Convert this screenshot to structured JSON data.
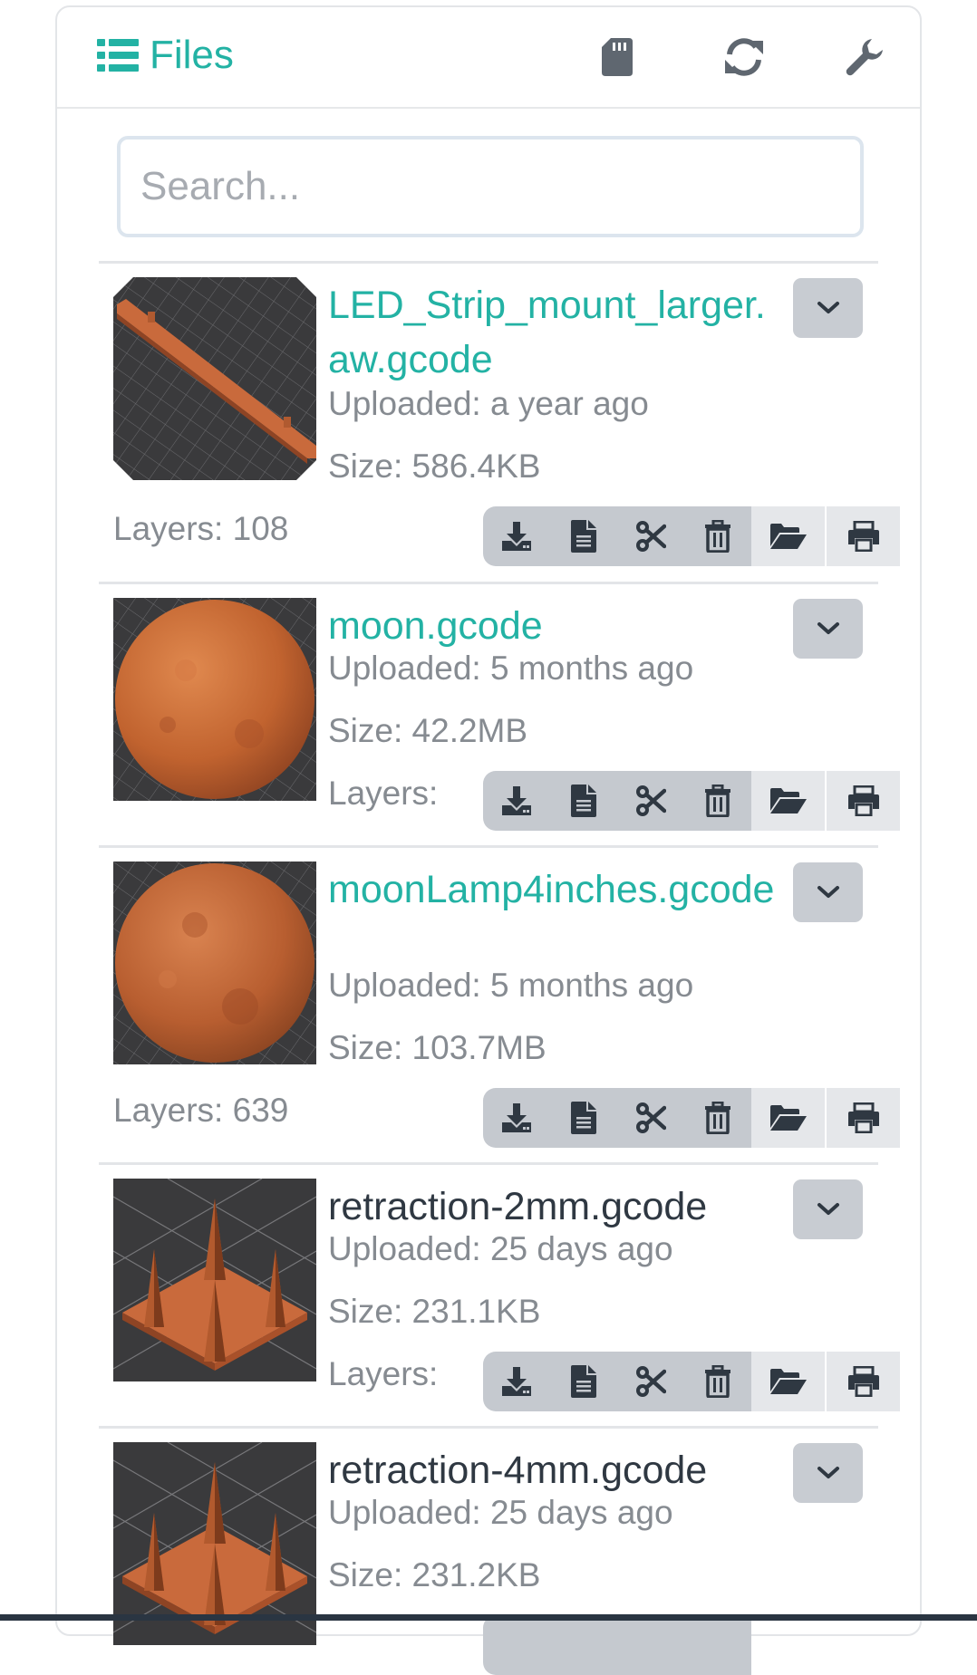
{
  "header": {
    "title": "Files",
    "icons": [
      "list-icon",
      "sd-card-icon",
      "refresh-icon",
      "wrench-icon"
    ]
  },
  "search": {
    "placeholder": "Search..."
  },
  "colors": {
    "accent": "#23b2a4",
    "text_dark": "#2f3842",
    "muted": "#868b91",
    "button_gray": "#c8ccd2",
    "thumb_bg": "#3a3a3c",
    "model": "#c96a3c"
  },
  "files": [
    {
      "name": "LED_Strip_mount_larger.aw.gcode",
      "uploaded": "Uploaded: a year ago",
      "size": "Size: 586.4KB",
      "layers": "Layers: 108",
      "thumbnail": "led-strip-thumbnail"
    },
    {
      "name": "moon.gcode",
      "uploaded": "Uploaded: 5 months ago",
      "size": "Size: 42.2MB",
      "layers": "Layers:",
      "thumbnail": "moon-thumbnail"
    },
    {
      "name": "moonLamp4inches.gcode",
      "uploaded": "Uploaded: 5 months ago",
      "size": "Size: 103.7MB",
      "layers": "Layers: 639",
      "thumbnail": "moon-lamp-thumbnail"
    },
    {
      "name": "retraction-2mm.gcode",
      "uploaded": "Uploaded: 25 days ago",
      "size": "Size: 231.1KB",
      "layers": "Layers:",
      "thumbnail": "retraction-spikes-thumbnail"
    },
    {
      "name": "retraction-4mm.gcode",
      "uploaded": "Uploaded: 25 days ago",
      "size": "Size: 231.2KB",
      "layers": "",
      "thumbnail": "retraction-spikes-thumbnail"
    }
  ],
  "action_icons": [
    "download-icon",
    "file-text-icon",
    "scissors-icon",
    "trash-icon",
    "folder-open-icon",
    "print-icon"
  ]
}
